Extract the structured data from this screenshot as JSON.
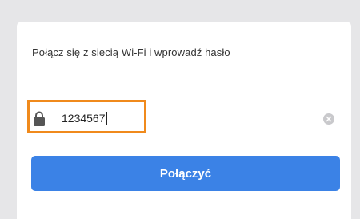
{
  "dialog": {
    "instruction": "Połącz się z siecią Wi-Fi i wprowadź hasło",
    "password": {
      "value": "1234567",
      "lock_icon": "lock-icon",
      "clear_icon": "clear-icon"
    },
    "connect_button": {
      "label": "Połączyć"
    }
  },
  "colors": {
    "primary_button": "#3b82e6",
    "highlight_border": "#f08a1c",
    "background": "#e6e6e8"
  }
}
